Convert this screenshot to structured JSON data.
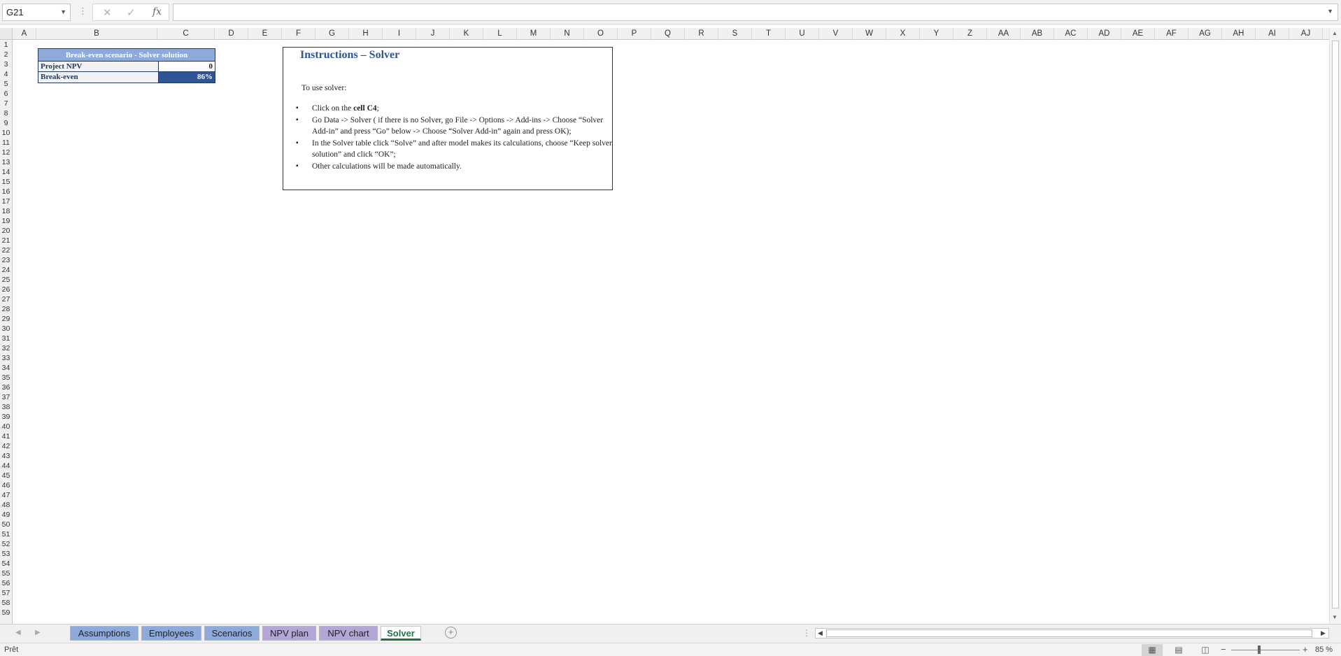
{
  "formula_bar": {
    "name_box": "G21",
    "formula": "",
    "icons": [
      "cancel-icon",
      "enter-icon",
      "function-icon"
    ],
    "fx_label": "fx"
  },
  "columns": [
    "A",
    "B",
    "C",
    "D",
    "E",
    "F",
    "G",
    "H",
    "I",
    "J",
    "K",
    "L",
    "M",
    "N",
    "O",
    "P",
    "Q",
    "R",
    "S",
    "T",
    "U",
    "V",
    "W",
    "X",
    "Y",
    "Z",
    "AA",
    "AB",
    "AC",
    "AD",
    "AE",
    "AF",
    "AG",
    "AH",
    "AI",
    "AJ"
  ],
  "rows": [
    "1",
    "2",
    "3",
    "4",
    "5",
    "6",
    "7",
    "8",
    "9",
    "10",
    "11",
    "12",
    "13",
    "14",
    "15",
    "16",
    "17",
    "18",
    "19",
    "20",
    "21",
    "22",
    "23",
    "24",
    "25",
    "26",
    "27",
    "28",
    "29",
    "30",
    "31",
    "32",
    "33",
    "34",
    "35",
    "36",
    "37",
    "38",
    "39",
    "40",
    "41",
    "42",
    "43",
    "44",
    "45",
    "46",
    "47",
    "48",
    "49",
    "50",
    "51",
    "52",
    "53",
    "54",
    "55",
    "56",
    "57",
    "58",
    "59"
  ],
  "solver_table": {
    "title": "Break-even scenario - Solver solution",
    "rows": [
      {
        "label": "Project NPV",
        "value": "0"
      },
      {
        "label": "Break-even",
        "value": "86%"
      }
    ]
  },
  "instructions": {
    "title": "Instructions – Solver",
    "intro": "To use solver:",
    "step1_prefix": "Click on the ",
    "step1_bold": "cell C4",
    "step1_suffix": ";",
    "step2": "Go Data -> Solver ( if there is no Solver, go File -> Options -> Add-ins -> Choose “Solver Add-in” and press “Go” below -> Choose “Solver Add-in” again and press OK);",
    "step3": "In the Solver table click “Solve” and after model makes its calculations, choose “Keep solver solution” and click “OK”;",
    "step4": "Other calculations will be made automatically."
  },
  "tabs": [
    {
      "label": "Assumptions",
      "color": "#8eaadb"
    },
    {
      "label": "Employees",
      "color": "#8eaadb"
    },
    {
      "label": "Scenarios",
      "color": "#8eaadb"
    },
    {
      "label": "NPV plan",
      "color": "#b4a7d6"
    },
    {
      "label": "NPV chart",
      "color": "#b4a7d6"
    },
    {
      "label": "Solver",
      "color": "#217346",
      "active": true
    }
  ],
  "status": {
    "ready": "Prêt",
    "zoom": "85 %"
  },
  "colors": {
    "header_blue": "#8eaadb",
    "dark_blue": "#2f5597",
    "excel_green": "#217346"
  }
}
